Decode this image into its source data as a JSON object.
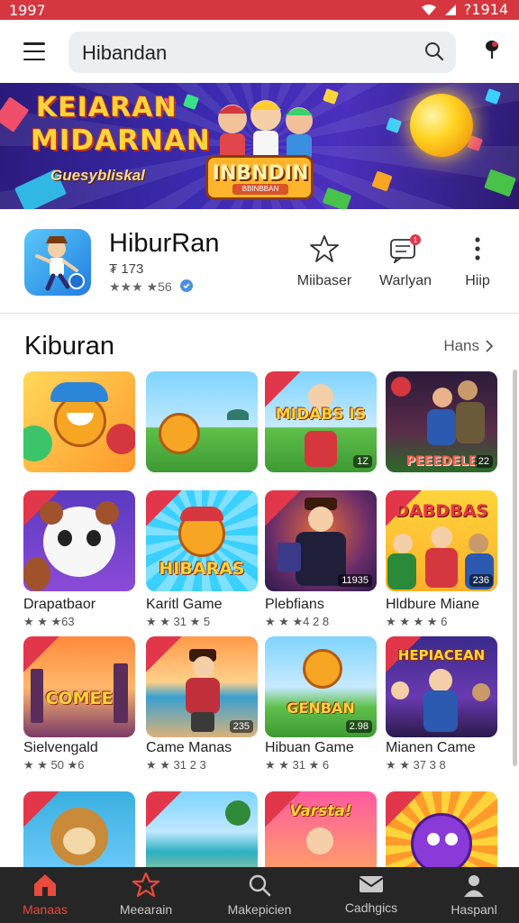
{
  "status_bar": {
    "time": "1997",
    "right_text": "?1914",
    "color": "#d6373f"
  },
  "search": {
    "text": "Hibandan"
  },
  "banner": {
    "title_line1": "KEIARAN",
    "title_line2": "MIDARNAN",
    "subtitle": "Guesybliskal",
    "logo_text": "INBNDIN",
    "logo_sub": "BBINBBAN"
  },
  "app": {
    "name": "HiburRan",
    "meta_line1": "₮ 173",
    "meta_line2": "★★★ ★56"
  },
  "actions": [
    {
      "label": "Miibaser",
      "icon": "star-outline-icon"
    },
    {
      "label": "Warlyan",
      "icon": "message-badge-icon",
      "badge": "1"
    },
    {
      "label": "Hiip",
      "icon": "more-vertical-icon"
    }
  ],
  "section": {
    "title": "Kiburan",
    "more_label": "Hans"
  },
  "tiles": [
    {
      "word": "",
      "badge": ""
    },
    {
      "word": "",
      "badge": ""
    },
    {
      "word": "MIDABS IS",
      "badge": "1Z"
    },
    {
      "word": "PEEEDELE",
      "badge": "22"
    },
    {
      "word": "",
      "badge": ""
    },
    {
      "word": "HIBARAS",
      "badge": ""
    },
    {
      "word": "",
      "badge": "11935"
    },
    {
      "word": "DABDBAS",
      "badge": "236"
    },
    {
      "word": "COMEE",
      "badge": ""
    },
    {
      "word": "",
      "badge": "235"
    },
    {
      "word": "GENBAN",
      "badge": "2.98"
    },
    {
      "word": "HEPIACEAN",
      "badge": ""
    },
    {
      "word": "",
      "badge": ""
    },
    {
      "word": "",
      "badge": ""
    },
    {
      "word": "Varsta!",
      "badge": ""
    },
    {
      "word": "",
      "badge": ""
    }
  ],
  "games": [
    {
      "name": "Drapatbaor",
      "rating": "★ ★ ★63"
    },
    {
      "name": "Karitl Game",
      "rating": "★ ★ 31 ★ 5"
    },
    {
      "name": "Plebfians",
      "rating": "★ ★ ★4 2 8"
    },
    {
      "name": "Hldbure Miane",
      "rating": "★ ★ ★ ★ 6"
    },
    {
      "name": "Sielvengald",
      "rating": "★ ★ 50 ★6"
    },
    {
      "name": "Came Manas",
      "rating": "★ ★ 31 2 3"
    },
    {
      "name": "Hibuan Game",
      "rating": "★ ★ 31 ★ 6"
    },
    {
      "name": "Mianen Came",
      "rating": "★ ★ 37 3 8"
    }
  ],
  "bottom_nav": [
    {
      "label": "Manaas",
      "icon": "home-icon",
      "active": true
    },
    {
      "label": "Meearain",
      "icon": "star-icon",
      "active": false
    },
    {
      "label": "Makepicien",
      "icon": "search-icon",
      "active": false
    },
    {
      "label": "Cadhgics",
      "icon": "mail-icon",
      "active": false
    },
    {
      "label": "Haspanl",
      "icon": "person-icon",
      "active": false
    }
  ],
  "colors": {
    "accent": "#e84a3c",
    "nav_bg": "#262626",
    "status": "#d6373f"
  }
}
